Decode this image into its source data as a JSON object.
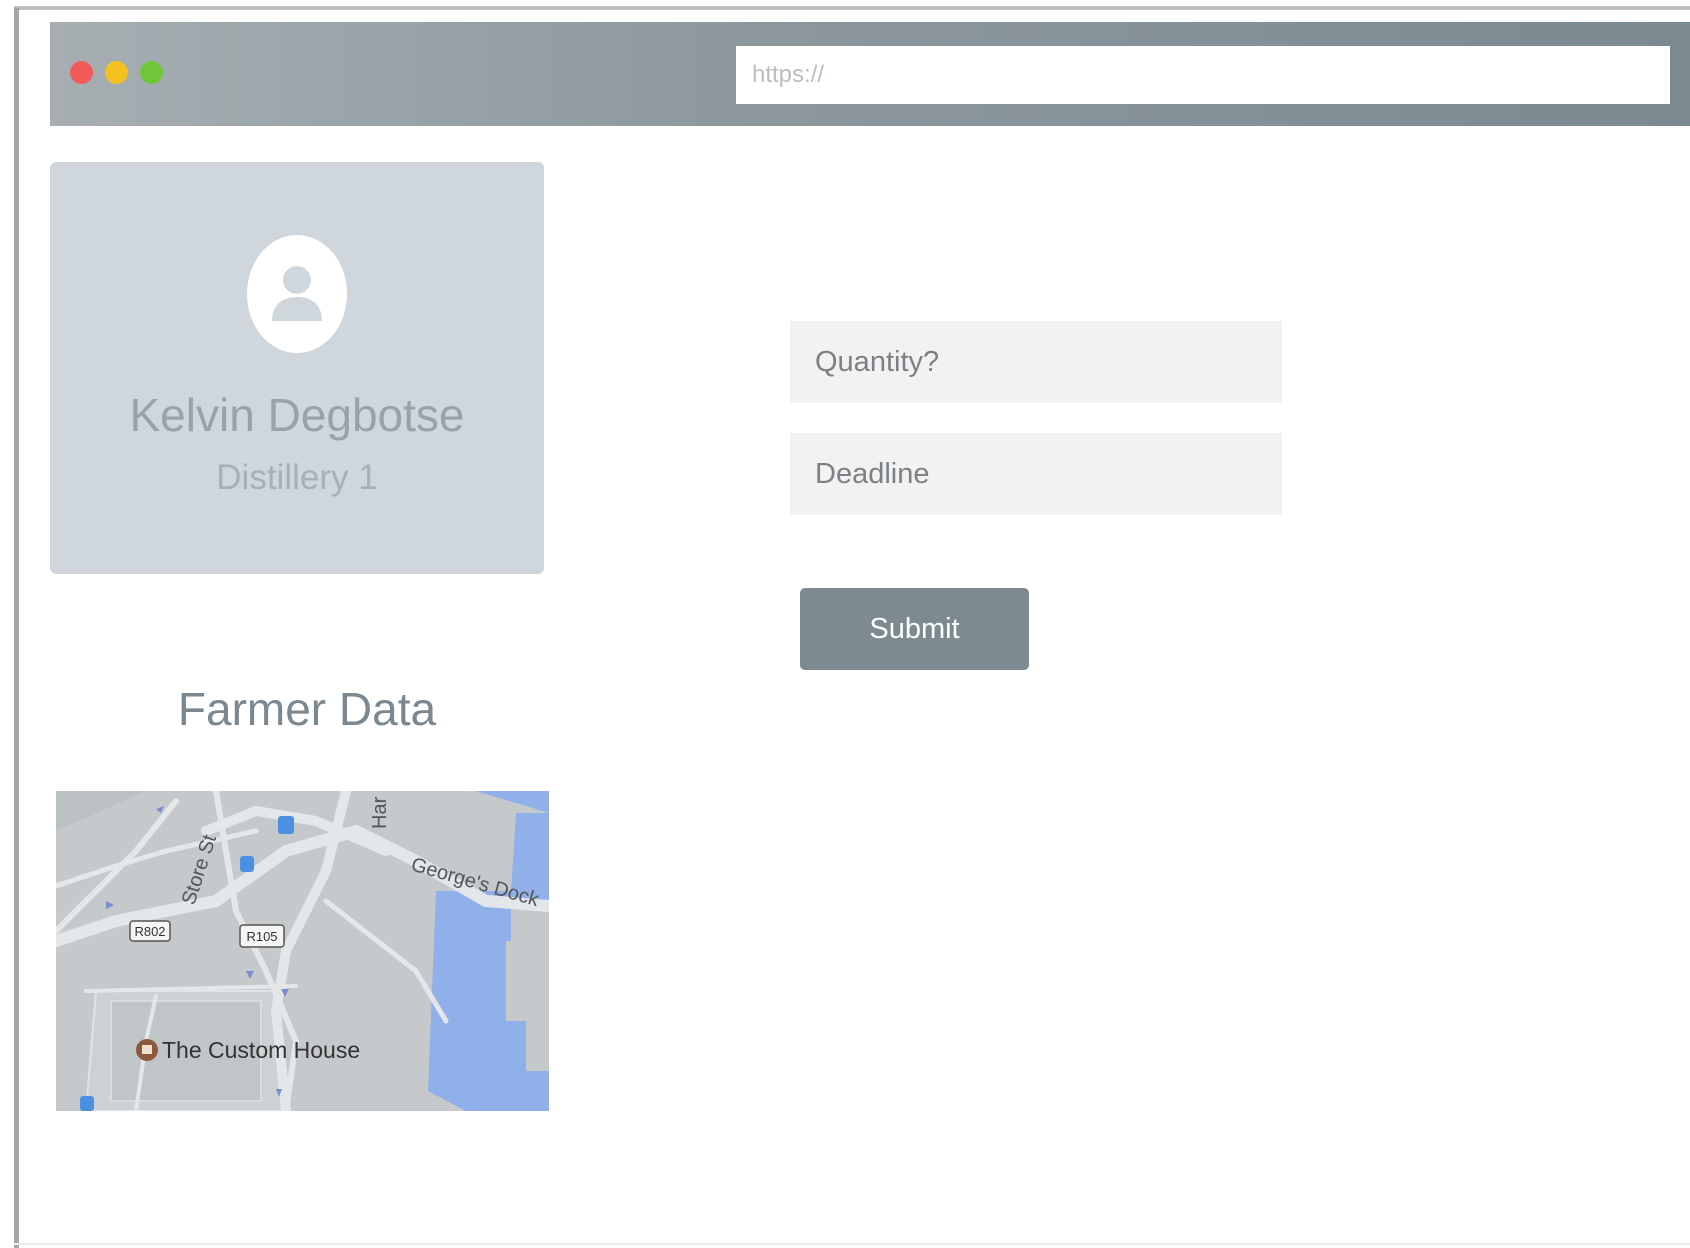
{
  "browser": {
    "url_placeholder": "https://"
  },
  "profile": {
    "name": "Kelvin Degbotse",
    "subtitle": "Distillery 1"
  },
  "farmer_data": {
    "title": "Farmer Data",
    "map": {
      "place_label": "The Custom House",
      "street_labels": [
        "Store St",
        "George's Dock",
        "Har"
      ],
      "road_shields": [
        "R802",
        "R105"
      ]
    }
  },
  "form": {
    "quantity_placeholder": "Quantity?",
    "deadline_placeholder": "Deadline",
    "submit_label": "Submit"
  },
  "colors": {
    "titlebar": "#8e999e",
    "card_bg": "#cfd7dc",
    "submit_bg": "#7d8a90",
    "field_bg": "#f2f2f2",
    "map_water": "#8fb0e8"
  },
  "icons": {
    "avatar": "user-icon"
  }
}
